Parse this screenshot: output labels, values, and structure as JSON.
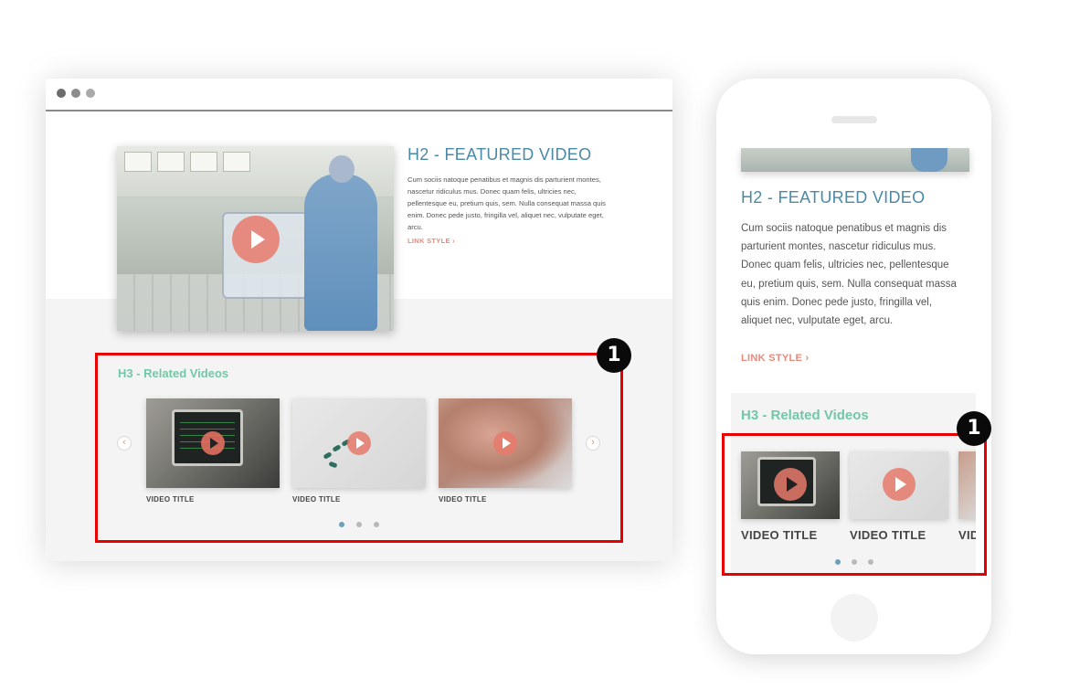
{
  "desktop": {
    "featured": {
      "title": "H2 - FEATURED VIDEO",
      "body": "Cum sociis natoque penatibus et magnis dis parturient montes, nascetur ridiculus mus. Donec quam felis, ultricies nec, pellentesque eu, pretium quis, sem. Nulla consequat massa quis enim. Donec pede justo, fringilla vel, aliquet nec, vulputate eget, arcu.",
      "link": "LINK STYLE ›"
    },
    "related": {
      "title": "H3 - Related Videos",
      "prev_label": "‹",
      "next_label": "›",
      "videos": [
        {
          "title": "VIDEO TITLE"
        },
        {
          "title": "VIDEO TITLE"
        },
        {
          "title": "VIDEO TITLE"
        }
      ],
      "page_count": 3,
      "active_page": 1
    }
  },
  "mobile": {
    "featured": {
      "title": "H2 - FEATURED VIDEO",
      "body": "Cum sociis natoque penatibus et magnis dis parturient montes, nascetur ridiculus mus. Donec quam felis, ultricies nec, pellentesque eu, pretium quis, sem. Nulla consequat massa quis enim. Donec pede justo, fringilla vel, aliquet nec, vulputate eget, arcu.",
      "link": "LINK STYLE ›"
    },
    "related": {
      "title": "H3 - Related Videos",
      "videos": [
        {
          "title": "VIDEO TITLE"
        },
        {
          "title": "VIDEO TITLE"
        },
        {
          "title": "VIDEO TITLE"
        }
      ],
      "page_count": 3,
      "active_page": 1
    }
  },
  "callouts": [
    {
      "label": "1"
    },
    {
      "label": "1"
    }
  ],
  "colors": {
    "heading": "#4a8aa6",
    "related_heading": "#72c7a6",
    "link": "#e88a7b",
    "play_button": "#e87a6c",
    "callout_border": "#e60000"
  },
  "icons": {
    "play": "play-icon",
    "prev": "chevron-left-icon",
    "next": "chevron-right-icon"
  }
}
